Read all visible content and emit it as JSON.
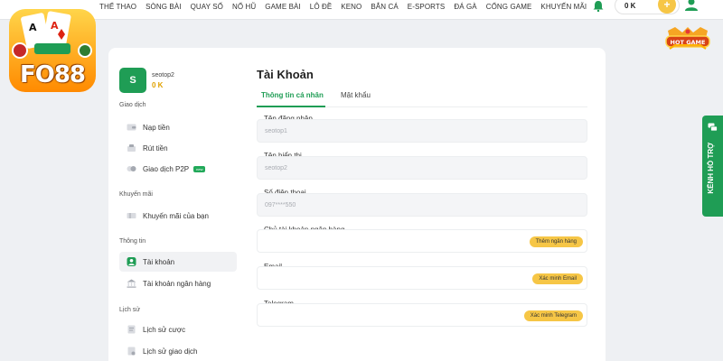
{
  "nav": [
    "THỂ THAO",
    "SÒNG BÀI",
    "QUAY SỐ",
    "NỔ HŨ",
    "GAME BÀI",
    "LÔ ĐỀ",
    "KENO",
    "BẮN CÁ",
    "E-SPORTS",
    "ĐÁ GÀ",
    "CỔNG GAME",
    "KHUYẾN MÃI"
  ],
  "header": {
    "balance": "0 K",
    "plus": "+"
  },
  "logo": {
    "text": "FO88"
  },
  "badge": {
    "text": "HOT GAME"
  },
  "user": {
    "initial": "S",
    "username": "seotop2",
    "balance": "0 K"
  },
  "sidebar": {
    "sections": {
      "transactions": "Giao dịch",
      "promotions": "Khuyến mãi",
      "info": "Thông tin",
      "history": "Lịch sử"
    },
    "items": {
      "deposit": "Nạp tiền",
      "withdraw": "Rút tiền",
      "p2p": "Giao dịch P2P",
      "p2p_tag": "new",
      "my_promos": "Khuyến mãi của bạn",
      "account": "Tài khoản",
      "bank_account": "Tài khoản ngân hàng",
      "bet_history": "Lịch sử cược",
      "trans_history": "Lịch sử giao dịch"
    }
  },
  "main": {
    "title": "Tài Khoản",
    "tabs": [
      "Thông tin cá nhân",
      "Mật khẩu"
    ],
    "fields": {
      "login_label": "Tên đăng nhập",
      "login_value": "seotop1",
      "display_label": "Tên hiển thị",
      "display_value": "seotop2",
      "phone_label": "Số điện thoại",
      "phone_value": "097****550",
      "bank_owner_label": "Chủ tài khoản ngân hàng",
      "bank_owner_btn": "Thêm ngân hàng",
      "email_label": "Email",
      "email_btn": "Xác minh Email",
      "telegram_label": "Telegram",
      "telegram_btn": "Xác minh Telegram"
    }
  },
  "support": {
    "label": "KÊNH HỖ TRỢ"
  },
  "colors": {
    "green": "#1f9d55",
    "yellow": "#f6c646",
    "background": "#eef0f3"
  }
}
